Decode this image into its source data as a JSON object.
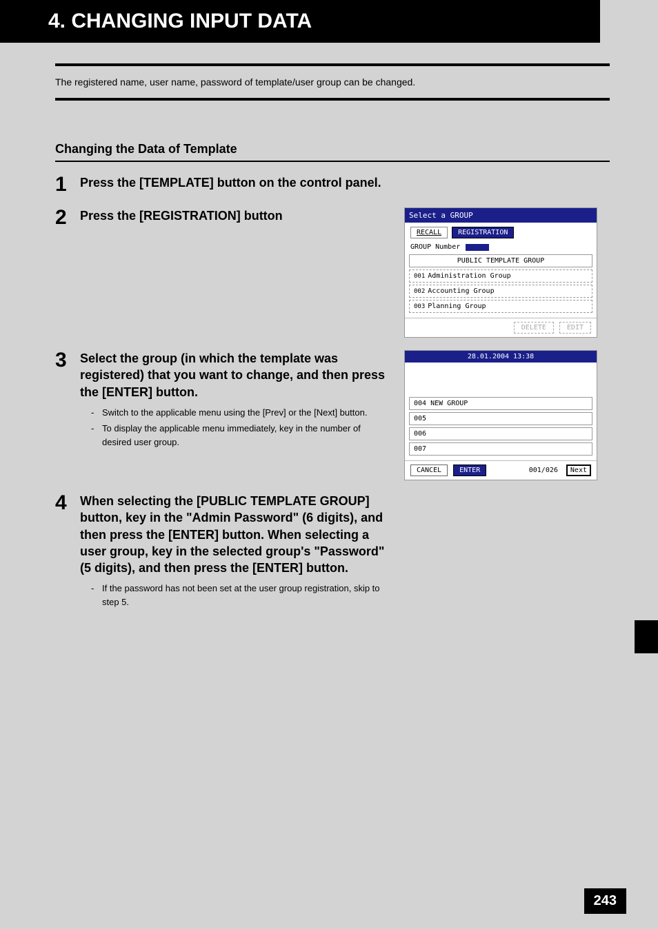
{
  "header": {
    "title": "4. CHANGING INPUT DATA"
  },
  "intro": "The registered name, user name, password of template/user group can be changed.",
  "section": {
    "title": "Changing the Data of Template"
  },
  "steps": {
    "s1": {
      "num": "1",
      "title": "Press the [TEMPLATE] button on the control panel."
    },
    "s2": {
      "num": "2",
      "title": "Press the [REGISTRATION] button"
    },
    "s3": {
      "num": "3",
      "title": "Select the group (in which the template was registered) that you want to change, and then press the [ENTER] button.",
      "bullet1": "Switch to the applicable menu using the [Prev] or the [Next] button.",
      "bullet2": "To display the applicable menu immediately, key in the number of desired user group."
    },
    "s4": {
      "num": "4",
      "title": "When selecting the [PUBLIC TEMPLATE GROUP] button, key in the \"Admin Password\" (6 digits), and then press the [ENTER] button. When selecting a user group, key in the selected group's \"Password\" (5 digits), and then press the [ENTER] button.",
      "bullet1": "If the password has not been set at the user group registration, skip to step 5."
    }
  },
  "fig1": {
    "title": "Select a GROUP",
    "tab_recall": "RECALL",
    "tab_registration": "REGISTRATION",
    "group_number_label": "GROUP Number",
    "row0": "PUBLIC TEMPLATE GROUP",
    "row1_num": "001",
    "row1": "Administration Group",
    "row2_num": "002",
    "row2": "Accounting Group",
    "row3_num": "003",
    "row3": "Planning Group",
    "btn_delete": "DELETE",
    "btn_edit": "EDIT"
  },
  "fig2": {
    "datetime": "28.01.2004 13:38",
    "row4_num": "004",
    "row4": "NEW GROUP",
    "row5": "005",
    "row6": "006",
    "row7": "007",
    "btn_cancel": "CANCEL",
    "btn_enter": "ENTER",
    "pager": "001/026",
    "btn_next": "Next"
  },
  "page_number": "243"
}
